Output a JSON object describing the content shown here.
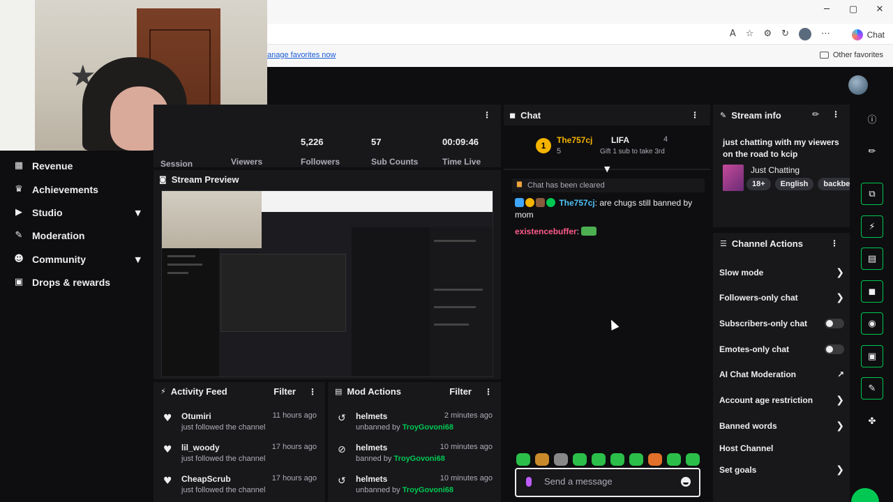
{
  "browser": {
    "favorites_link": "anage favorites now",
    "copilot_label": "Chat",
    "other_favorites": "Other favorites"
  },
  "nav": {
    "items": [
      {
        "label": "Revenue",
        "icon": "revenue-icon"
      },
      {
        "label": "Achievements",
        "icon": "trophy-icon"
      },
      {
        "label": "Studio",
        "icon": "video-icon"
      },
      {
        "label": "Moderation",
        "icon": "wrench-icon"
      },
      {
        "label": "Community",
        "icon": "people-icon"
      },
      {
        "label": "Drops & rewards",
        "icon": "gift-icon"
      }
    ]
  },
  "stats": {
    "session_label": "Session",
    "viewers_label": "Viewers",
    "followers_value": "5,226",
    "followers_label": "Followers",
    "subs_value": "57",
    "subs_label": "Sub Counts",
    "time_value": "00:09:46",
    "time_label": "Time Live"
  },
  "preview": {
    "title": "Stream Preview"
  },
  "activity": {
    "title": "Activity Feed",
    "filter": "Filter",
    "items": [
      {
        "name": "Otumiri",
        "sub": "just followed the channel",
        "time": "11 hours ago"
      },
      {
        "name": "lil_woody",
        "sub": "just followed the channel",
        "time": "17 hours ago"
      },
      {
        "name": "CheapScrub",
        "sub": "just followed the channel",
        "time": "17 hours ago"
      }
    ]
  },
  "mod": {
    "title": "Mod Actions",
    "filter": "Filter",
    "items": [
      {
        "name": "helmets",
        "action": "unbanned by",
        "by": "TroyGovoni68",
        "time": "2 minutes ago"
      },
      {
        "name": "helmets",
        "action": "banned by",
        "by": "TroyGovoni68",
        "time": "10 minutes ago"
      },
      {
        "name": "helmets",
        "action": "unbanned by",
        "by": "TroyGovoni68",
        "time": "10 minutes ago"
      }
    ]
  },
  "chat": {
    "title": "Chat",
    "leader_rank": "1",
    "leader_name": "The757cj",
    "leader_count": "5",
    "second_name": "LIFA",
    "second_count": "4",
    "gift_text": "Gift 1 sub to take 3rd",
    "cleared": "Chat has been cleared",
    "msg1_user": "The757cj",
    "msg1_text": ": are chugs still banned by mom",
    "msg2_user": "existencebuffer",
    "msg2_text": ":",
    "input_placeholder": "Send a message"
  },
  "stream_info": {
    "title": "Stream info",
    "stream_title": "just chatting with my viewers on the road to kcip",
    "category": "Just Chatting",
    "tags": [
      "18+",
      "English",
      "backbe"
    ]
  },
  "channel_actions": {
    "title": "Channel Actions",
    "items": [
      {
        "label": "Slow mode",
        "control": "arrow"
      },
      {
        "label": "Followers-only chat",
        "control": "arrow"
      },
      {
        "label": "Subscribers-only chat",
        "control": "toggle"
      },
      {
        "label": "Emotes-only chat",
        "control": "toggle"
      },
      {
        "label": "AI Chat Moderation",
        "control": "external"
      },
      {
        "label": "Account age restriction",
        "control": "arrow"
      },
      {
        "label": "Banned words",
        "control": "arrow"
      },
      {
        "label": "Host Channel",
        "control": "none"
      },
      {
        "label": "Set goals",
        "control": "arrow"
      }
    ]
  },
  "colors": {
    "accent_green": "#00c853",
    "gold": "#f5b400",
    "chat_user_blue": "#4fc3f7",
    "chat_user_pink": "#ff5a8a"
  }
}
